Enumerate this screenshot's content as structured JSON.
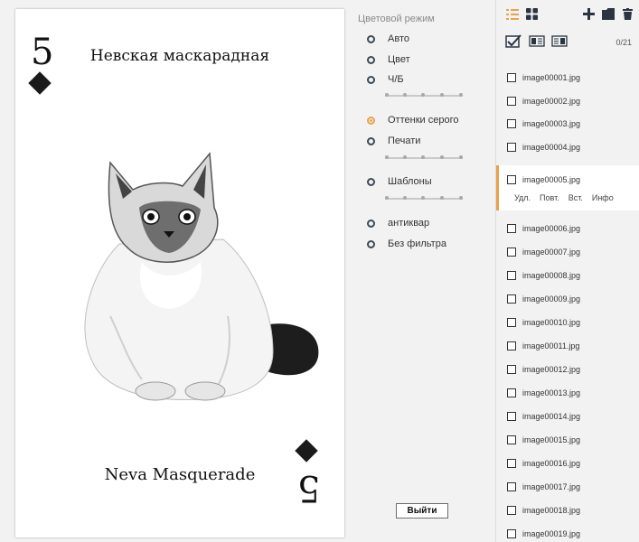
{
  "card": {
    "number": "5",
    "number_flipped": "5",
    "title_top": "Невская маскарадная",
    "title_bottom": "Neva Masquerade"
  },
  "filters": {
    "section_title": "Цветовой режим",
    "options": [
      {
        "label": "Авто",
        "checked": false
      },
      {
        "label": "Цвет",
        "checked": false
      },
      {
        "label": "Ч/Б",
        "checked": false
      },
      {
        "label": "Оттенки серого",
        "checked": true
      },
      {
        "label": "Печати",
        "checked": false
      },
      {
        "label": "Шаблоны",
        "checked": false
      },
      {
        "label": "антиквар",
        "checked": false
      },
      {
        "label": "Без фильтра",
        "checked": false
      }
    ],
    "exit_label": "Выйти"
  },
  "files": {
    "counter": "0/21",
    "selected": {
      "name": "image00005.jpg",
      "actions": [
        "Удл.",
        "Повт.",
        "Вст.",
        "Инфо"
      ]
    },
    "items": [
      "image00001.jpg",
      "image00002.jpg",
      "image00003.jpg",
      "image00004.jpg",
      "image00006.jpg",
      "image00007.jpg",
      "image00008.jpg",
      "image00009.jpg",
      "image00010.jpg",
      "image00011.jpg",
      "image00012.jpg",
      "image00013.jpg",
      "image00014.jpg",
      "image00015.jpg",
      "image00016.jpg",
      "image00017.jpg",
      "image00018.jpg",
      "image00019.jpg"
    ]
  },
  "colors": {
    "accent": "#e8a34a",
    "panel_bg": "#f2f2f2",
    "dark_icon": "#2b3440"
  }
}
